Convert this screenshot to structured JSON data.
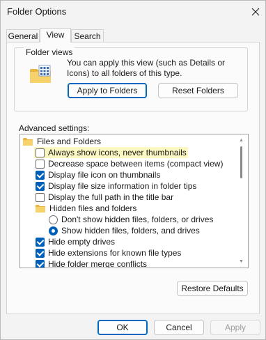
{
  "window": {
    "title": "Folder Options"
  },
  "tabs": [
    {
      "label": "General"
    },
    {
      "label": "View"
    },
    {
      "label": "Search"
    }
  ],
  "folder_views": {
    "group_label": "Folder views",
    "description": "You can apply this view (such as Details or Icons) to all folders of this type.",
    "apply_button": "Apply to Folders",
    "reset_button": "Reset Folders"
  },
  "advanced": {
    "label": "Advanced settings:",
    "items": [
      {
        "type": "folder",
        "label": "Files and Folders",
        "indent": 0
      },
      {
        "type": "checkbox",
        "label": "Always show icons, never thumbnails",
        "checked": false,
        "highlighted": true,
        "indent": 1
      },
      {
        "type": "checkbox",
        "label": "Decrease space between items (compact view)",
        "checked": false,
        "indent": 1
      },
      {
        "type": "checkbox",
        "label": "Display file icon on thumbnails",
        "checked": true,
        "indent": 1
      },
      {
        "type": "checkbox",
        "label": "Display file size information in folder tips",
        "checked": true,
        "indent": 1
      },
      {
        "type": "checkbox",
        "label": "Display the full path in the title bar",
        "checked": false,
        "indent": 1
      },
      {
        "type": "folder",
        "label": "Hidden files and folders",
        "indent": 1
      },
      {
        "type": "radio",
        "label": "Don't show hidden files, folders, or drives",
        "checked": false,
        "indent": 2
      },
      {
        "type": "radio",
        "label": "Show hidden files, folders, and drives",
        "checked": true,
        "indent": 2
      },
      {
        "type": "checkbox",
        "label": "Hide empty drives",
        "checked": true,
        "indent": 1
      },
      {
        "type": "checkbox",
        "label": "Hide extensions for known file types",
        "checked": true,
        "indent": 1
      },
      {
        "type": "checkbox",
        "label": "Hide folder merge conflicts",
        "checked": true,
        "indent": 1
      }
    ]
  },
  "restore_defaults_button": "Restore Defaults",
  "footer": {
    "ok": "OK",
    "cancel": "Cancel",
    "apply": "Apply"
  },
  "colors": {
    "accent": "#005fb8",
    "highlight": "#fbf7c1",
    "folder": "#f3c94b"
  },
  "icons": {
    "close": "close-icon",
    "folder": "folder-icon",
    "folder_views": "folder-views-icon"
  }
}
